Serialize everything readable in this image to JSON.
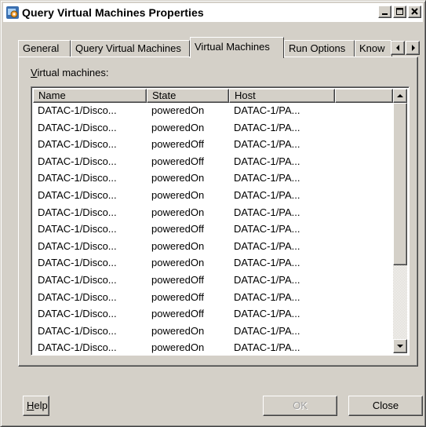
{
  "window": {
    "title": "Query Virtual Machines Properties"
  },
  "tabs": [
    {
      "label": "General"
    },
    {
      "label": "Query Virtual Machines"
    },
    {
      "label": "Virtual Machines",
      "selected": true
    },
    {
      "label": "Run Options"
    },
    {
      "label": "Know"
    }
  ],
  "list": {
    "label_prefix": "V",
    "label_rest": "irtual machines:",
    "columns": [
      "Name",
      "State",
      "Host",
      ""
    ],
    "rows": [
      {
        "name": "DATAC-1/Disco...",
        "state": "poweredOn",
        "host": "DATAC-1/PA..."
      },
      {
        "name": "DATAC-1/Disco...",
        "state": "poweredOn",
        "host": "DATAC-1/PA..."
      },
      {
        "name": "DATAC-1/Disco...",
        "state": "poweredOff",
        "host": "DATAC-1/PA..."
      },
      {
        "name": "DATAC-1/Disco...",
        "state": "poweredOff",
        "host": "DATAC-1/PA..."
      },
      {
        "name": "DATAC-1/Disco...",
        "state": "poweredOn",
        "host": "DATAC-1/PA..."
      },
      {
        "name": "DATAC-1/Disco...",
        "state": "poweredOn",
        "host": "DATAC-1/PA..."
      },
      {
        "name": "DATAC-1/Disco...",
        "state": "poweredOn",
        "host": "DATAC-1/PA..."
      },
      {
        "name": "DATAC-1/Disco...",
        "state": "poweredOff",
        "host": "DATAC-1/PA..."
      },
      {
        "name": "DATAC-1/Disco...",
        "state": "poweredOn",
        "host": "DATAC-1/PA..."
      },
      {
        "name": "DATAC-1/Disco...",
        "state": "poweredOn",
        "host": "DATAC-1/PA..."
      },
      {
        "name": "DATAC-1/Disco...",
        "state": "poweredOff",
        "host": "DATAC-1/PA..."
      },
      {
        "name": "DATAC-1/Disco...",
        "state": "poweredOff",
        "host": "DATAC-1/PA..."
      },
      {
        "name": "DATAC-1/Disco...",
        "state": "poweredOff",
        "host": "DATAC-1/PA..."
      },
      {
        "name": "DATAC-1/Disco...",
        "state": "poweredOn",
        "host": "DATAC-1/PA..."
      },
      {
        "name": "DATAC-1/Disco...",
        "state": "poweredOn",
        "host": "DATAC-1/PA..."
      }
    ]
  },
  "buttons": {
    "help_prefix": "H",
    "help_rest": "elp",
    "ok": "OK",
    "close": "Close"
  },
  "icons": {
    "app": "virtual-machines-icon",
    "minimize": "minimize-icon",
    "maximize": "maximize-icon",
    "close": "close-icon",
    "scroll_left": "arrow-left-icon",
    "scroll_right": "arrow-right-icon",
    "scroll_up": "arrow-up-icon",
    "scroll_down": "arrow-down-icon"
  },
  "colors": {
    "face": "#d4d0c8",
    "title_bg": "#ffffff",
    "list_bg": "#ffffff"
  }
}
